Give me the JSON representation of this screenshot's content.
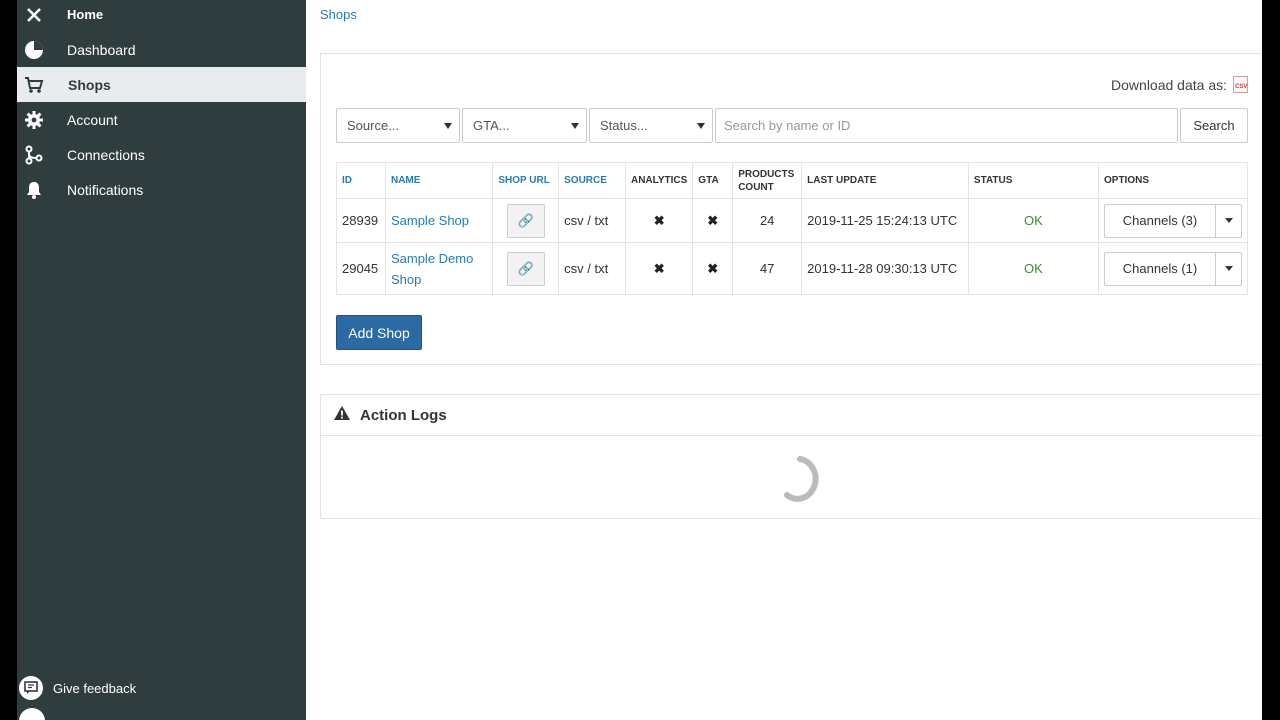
{
  "sidebar": {
    "items": [
      {
        "label": "Home",
        "icon": "close-icon"
      },
      {
        "label": "Dashboard",
        "icon": "pie-chart-icon"
      },
      {
        "label": "Shops",
        "icon": "cart-icon"
      },
      {
        "label": "Account",
        "icon": "gear-icon"
      },
      {
        "label": "Connections",
        "icon": "connections-icon"
      },
      {
        "label": "Notifications",
        "icon": "bell-icon"
      }
    ],
    "feedback_label": "Give feedback"
  },
  "breadcrumb": "Shops",
  "download": {
    "label": "Download data as:",
    "icon_text": "CSV"
  },
  "filters": {
    "source": "Source...",
    "gta": "GTA...",
    "status": "Status...",
    "search_placeholder": "Search by name or ID",
    "search_button": "Search"
  },
  "table": {
    "headers": [
      "ID",
      "NAME",
      "SHOP URL",
      "SOURCE",
      "ANALYTICS",
      "GTA",
      "PRODUCTS COUNT",
      "LAST UPDATE",
      "STATUS",
      "OPTIONS"
    ],
    "rows": [
      {
        "id": "28939",
        "name": "Sample Shop",
        "source": "csv / txt",
        "analytics": "✖",
        "gta": "✖",
        "products": "24",
        "last_update": "2019-11-25 15:24:13 UTC",
        "status": "OK",
        "options": "Channels (3)"
      },
      {
        "id": "29045",
        "name": "Sample Demo Shop",
        "source": "csv / txt",
        "analytics": "✖",
        "gta": "✖",
        "products": "47",
        "last_update": "2019-11-28 09:30:13 UTC",
        "status": "OK",
        "options": "Channels (1)"
      }
    ]
  },
  "add_shop_label": "Add Shop",
  "logs": {
    "title": "Action Logs"
  },
  "colors": {
    "sidebar": "#2f3d3e",
    "link": "#2a7ab0",
    "primary": "#2b6aa3",
    "ok": "#3c8a3c"
  }
}
